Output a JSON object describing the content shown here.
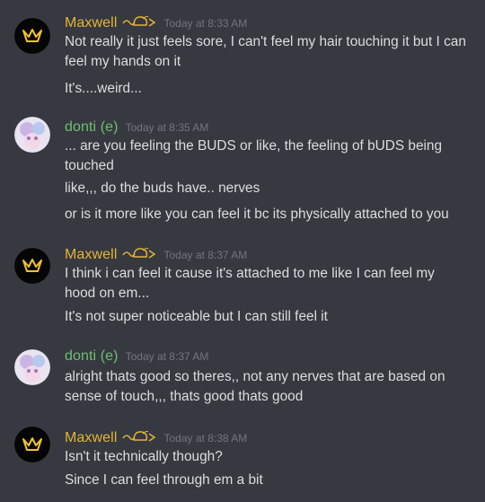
{
  "colors": {
    "background": "#36393f",
    "text": "#dcddde",
    "timestamp": "#72767d",
    "maxwell_name": "#e6b338",
    "donti_name": "#6fbf73"
  },
  "messages": [
    {
      "author": "Maxwell",
      "avatar_icon": "crown-icon",
      "timestamp": "Today at 8:33 AM",
      "lines": [
        "Not really it just feels sore, I can't feel my hair touching it but I can feel my hands on it",
        "It's....weird..."
      ]
    },
    {
      "author": "donti (e)",
      "avatar_icon": "anime-avatar-icon",
      "timestamp": "Today at 8:35 AM",
      "lines": [
        "... are you feeling the BUDS or like, the feeling of bUDS being touched",
        "like,,, do the buds have.. nerves",
        "or is it more like you can feel it bc its physically attached to you"
      ]
    },
    {
      "author": "Maxwell",
      "avatar_icon": "crown-icon",
      "timestamp": "Today at 8:37 AM",
      "lines": [
        "I think i can feel it cause it's attached to me like I can feel my hood on em...",
        "It's not super noticeable but I can still feel it"
      ]
    },
    {
      "author": "donti (e)",
      "avatar_icon": "anime-avatar-icon",
      "timestamp": "Today at 8:37 AM",
      "lines": [
        "alright thats good so theres,, not any nerves that are based on sense of touch,,, thats good thats good"
      ]
    },
    {
      "author": "Maxwell",
      "avatar_icon": "crown-icon",
      "timestamp": "Today at 8:38 AM",
      "lines": [
        "Isn't it technically though?",
        "Since I can feel through em a bit"
      ]
    }
  ]
}
